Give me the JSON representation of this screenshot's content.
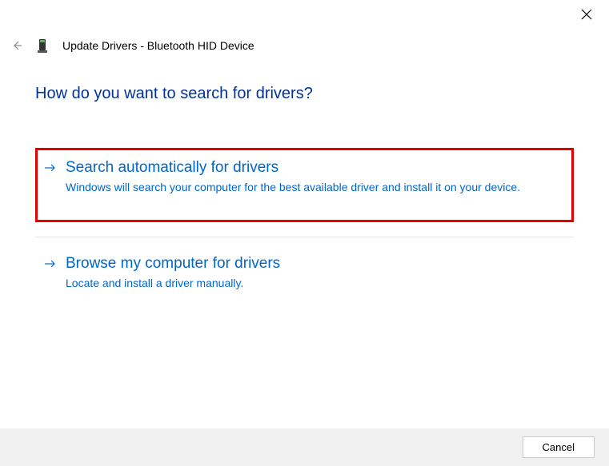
{
  "titlebar": {
    "close_icon": "close"
  },
  "header": {
    "back_icon": "back-arrow",
    "device_icon": "device",
    "title": "Update Drivers - Bluetooth HID Device"
  },
  "main": {
    "heading": "How do you want to search for drivers?",
    "options": [
      {
        "arrow_icon": "right-arrow",
        "title": "Search automatically for drivers",
        "description": "Windows will search your computer for the best available driver and install it on your device.",
        "highlighted": true
      },
      {
        "arrow_icon": "right-arrow",
        "title": "Browse my computer for drivers",
        "description": "Locate and install a driver manually.",
        "highlighted": false
      }
    ]
  },
  "footer": {
    "cancel_label": "Cancel"
  }
}
